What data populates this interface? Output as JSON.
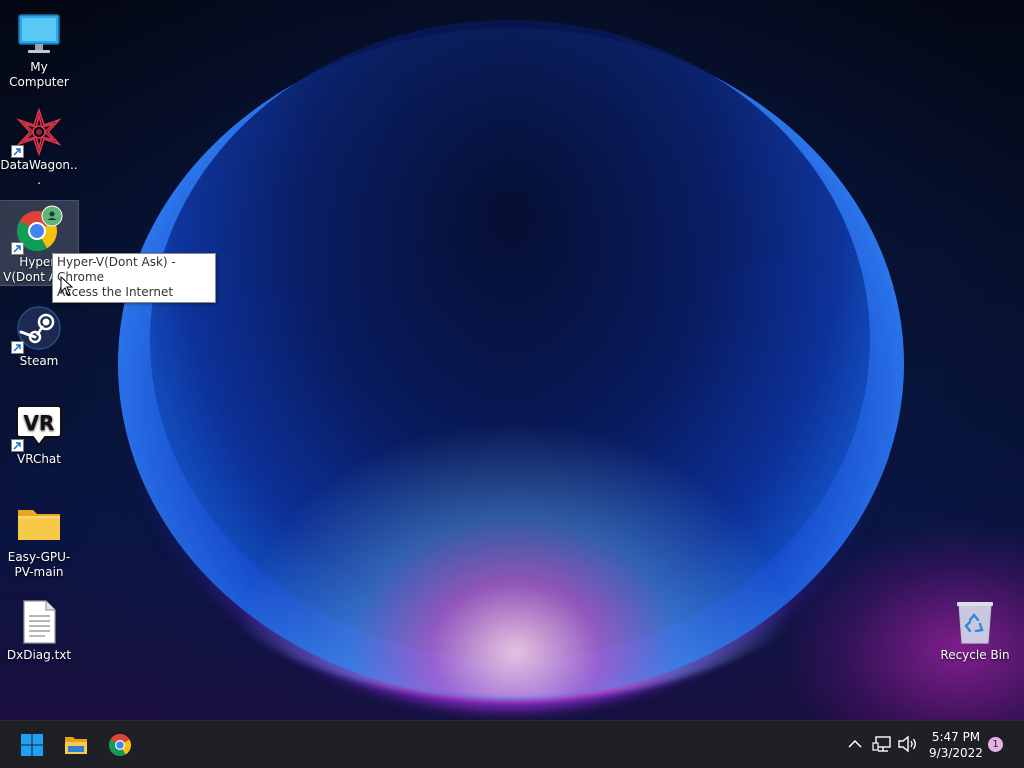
{
  "desktop": {
    "icons": [
      {
        "id": "my-computer",
        "label": "My Computer",
        "icon": "monitor-icon"
      },
      {
        "id": "datawagon",
        "label": "DataWagon...",
        "icon": "datawagon-logo-icon",
        "shortcut": true
      },
      {
        "id": "hyperv-chrome",
        "label": "Hyper-V(Dont Ask) - Chrome",
        "icon": "chrome-profile-icon",
        "shortcut": true,
        "selected": true
      },
      {
        "id": "steam",
        "label": "Steam",
        "icon": "steam-icon",
        "shortcut": true
      },
      {
        "id": "vrchat",
        "label": "VRChat",
        "icon": "vrchat-icon",
        "shortcut": true,
        "icon_text": "VR"
      },
      {
        "id": "easy-gpu-pv",
        "label": "Easy-GPU-PV-main",
        "icon": "folder-icon"
      },
      {
        "id": "dxdiag",
        "label": "DxDiag.txt",
        "icon": "text-file-icon"
      },
      {
        "id": "recycle-bin",
        "label": "Recycle Bin",
        "icon": "recycle-bin-icon"
      }
    ],
    "tooltip": {
      "line1": "Hyper-V(Dont Ask) - Chrome",
      "line2": "Access the Internet"
    }
  },
  "taskbar": {
    "pinned": [
      {
        "name": "start",
        "icon": "windows-start-icon"
      },
      {
        "name": "file-explorer",
        "icon": "file-explorer-icon"
      },
      {
        "name": "chrome",
        "icon": "chrome-icon"
      }
    ],
    "tray": {
      "icons": [
        "chevron-up-icon",
        "network-icon",
        "speaker-icon"
      ],
      "time": "5:47 PM",
      "date": "9/3/2022",
      "notification_count": "1"
    }
  },
  "colors": {
    "taskbar_bg": "#1f2025",
    "windows_blue": "#1ea1f1",
    "folder_yellow": "#f7c948"
  }
}
